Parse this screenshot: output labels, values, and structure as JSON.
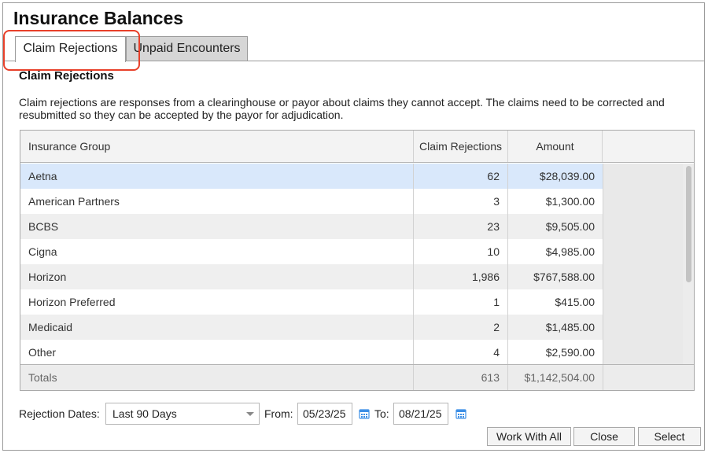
{
  "app": {
    "title": "Insurance Balances"
  },
  "tabs": [
    {
      "label": "Claim Rejections",
      "active": true
    },
    {
      "label": "Unpaid Encounters",
      "active": false
    }
  ],
  "section": {
    "title": "Claim Rejections",
    "description": "Claim rejections are responses from a clearinghouse or payor about claims they cannot accept. The claims need to be corrected and resubmitted so they can be accepted by the payor for adjudication."
  },
  "table": {
    "columns": {
      "insurance_group": "Insurance Group",
      "claim_rejections": "Claim Rejections",
      "amount": "Amount"
    },
    "rows": [
      {
        "group": "Aetna",
        "rejections": "62",
        "amount": "$28,039.00"
      },
      {
        "group": "American Partners",
        "rejections": "3",
        "amount": "$1,300.00"
      },
      {
        "group": "BCBS",
        "rejections": "23",
        "amount": "$9,505.00"
      },
      {
        "group": "Cigna",
        "rejections": "10",
        "amount": "$4,985.00"
      },
      {
        "group": "Horizon",
        "rejections": "1,986",
        "amount": "$767,588.00"
      },
      {
        "group": "Horizon Preferred",
        "rejections": "1",
        "amount": "$415.00"
      },
      {
        "group": "Medicaid",
        "rejections": "2",
        "amount": "$1,485.00"
      },
      {
        "group": "Other",
        "rejections": "4",
        "amount": "$2,590.00"
      }
    ],
    "selected_row": "Aetna",
    "totals": {
      "label": "Totals",
      "rejections": "613",
      "amount": "$1,142,504.00"
    }
  },
  "filters": {
    "rejection_dates_label": "Rejection Dates:",
    "range_value": "Last 90 Days",
    "from_label": "From:",
    "from_value": "05/23/25",
    "to_label": "To:",
    "to_value": "08/21/25",
    "calendar_icon": "calendar-icon"
  },
  "buttons": {
    "work_with_all": "Work With All",
    "close": "Close",
    "select": "Select"
  },
  "colors": {
    "highlight": "#e8402a",
    "selected_row": "#d9e8fb",
    "calendar_icon": "#3d8fe6"
  }
}
